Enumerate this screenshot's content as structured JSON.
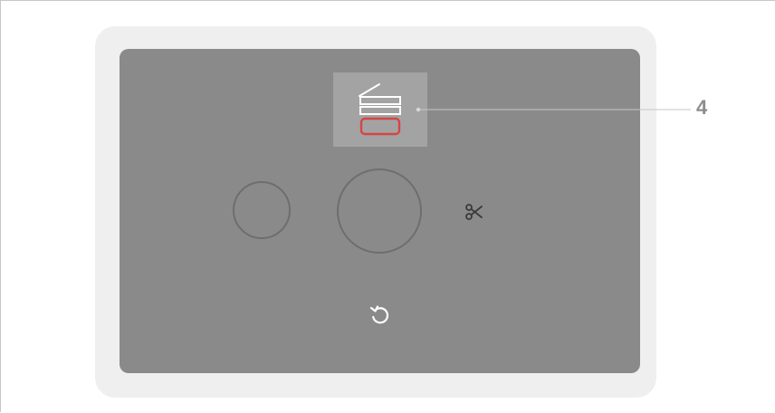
{
  "callout": {
    "number": "4",
    "color": "#8c8c8c"
  },
  "device": {
    "bezel_color": "#efefef",
    "screen_color": "#8a8a8a",
    "tile_color": "#a3a3a3",
    "highlight_color": "#d64545",
    "icons": {
      "tray": "paper-tray-icon",
      "cut": "scissors-icon",
      "reset": "reset-icon"
    }
  }
}
